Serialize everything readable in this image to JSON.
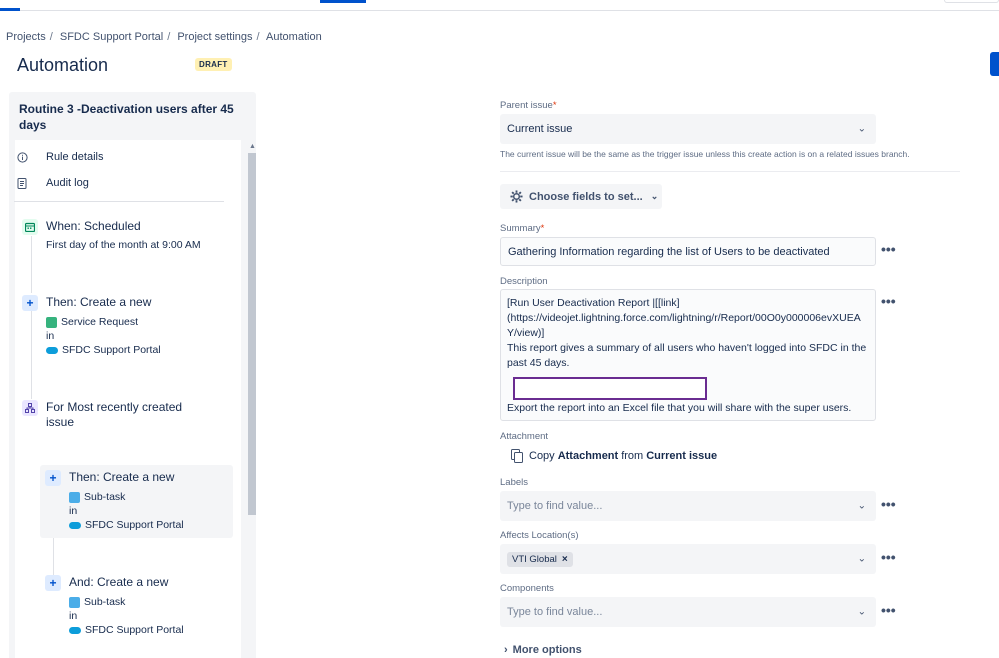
{
  "breadcrumb": [
    "Projects",
    "SFDC Support Portal",
    "Project settings",
    "Automation"
  ],
  "page": {
    "title": "Automation",
    "badge": "DRAFT"
  },
  "rule": {
    "title": "Routine 3 -Deactivation users after 45 days",
    "menu": [
      {
        "label": "Rule details",
        "icon": "info-icon"
      },
      {
        "label": "Audit log",
        "icon": "document-icon"
      }
    ],
    "steps": {
      "trigger": {
        "head": "When: Scheduled",
        "sub": "First day of the month at 9:00 AM"
      },
      "create1": {
        "head": "Then: Create a new",
        "issue_type": "Service Request",
        "in": "in",
        "project": "SFDC Support Portal"
      },
      "branch": {
        "head": "For Most recently created issue"
      },
      "create2": {
        "head": "Then: Create a new",
        "issue_type": "Sub-task",
        "in": "in",
        "project": "SFDC Support Portal"
      },
      "create3": {
        "head": "And: Create a new",
        "issue_type": "Sub-task",
        "in": "in",
        "project": "SFDC Support Portal"
      }
    }
  },
  "form": {
    "parent_issue": {
      "label": "Parent issue",
      "value": "Current issue",
      "helper": "The current issue will be the same as the trigger issue unless this create action is on a related issues branch."
    },
    "choose_fields_label": "Choose fields to set...",
    "summary": {
      "label": "Summary",
      "value": "Gathering Information regarding the list of Users to be deactivated"
    },
    "description": {
      "label": "Description",
      "lines": [
        "[Run User Deactivation Report |[[link]",
        "(https://videojet.lightning.force.com/lightning/r/Report/00O0y000006evXUEA",
        "Y/view)]",
        "This report gives a summary of all users who haven't logged into SFDC in the",
        "past 45 days.",
        "Export the report into an Excel file that you will share with the super users."
      ]
    },
    "attachment": {
      "label": "Attachment",
      "prefix": "Copy",
      "bold1": "Attachment",
      "middle": "from",
      "bold2": "Current issue"
    },
    "labels": {
      "label": "Labels",
      "placeholder": "Type to find value..."
    },
    "affects_location": {
      "label": "Affects Location(s)",
      "chip": "VTI Global"
    },
    "components": {
      "label": "Components",
      "placeholder": "Type to find value..."
    },
    "more_options": "More options"
  },
  "colors": {
    "accent": "#0052cc",
    "draft_bg": "#fff0b3",
    "redaction_border": "#6a2c91"
  }
}
